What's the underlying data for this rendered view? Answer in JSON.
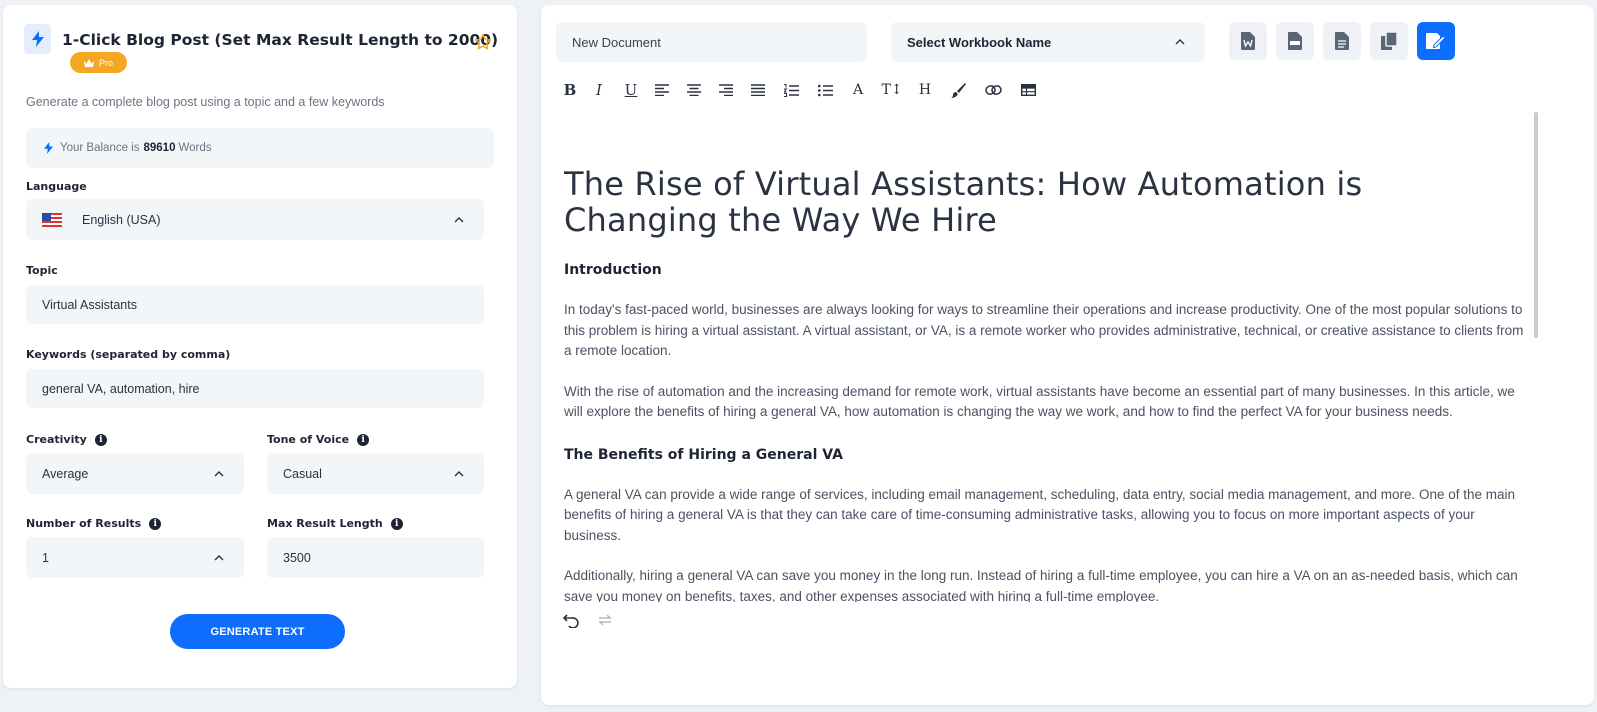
{
  "tool": {
    "title": "1-Click Blog Post (Set Max Result Length to 2000)",
    "badge": "Pro",
    "description": "Generate a complete blog post using a topic and a few keywords",
    "balance_prefix": "Your Balance is",
    "balance_value": "89610",
    "balance_suffix": "Words"
  },
  "form": {
    "language_label": "Language",
    "language_value": "English (USA)",
    "topic_label": "Topic",
    "topic_value": "Virtual Assistants",
    "keywords_label": "Keywords (separated by comma)",
    "keywords_value": "general VA, automation, hire",
    "creativity_label": "Creativity",
    "creativity_value": "Average",
    "tone_label": "Tone of Voice",
    "tone_value": "Casual",
    "results_label": "Number of Results",
    "results_value": "1",
    "maxlen_label": "Max Result Length",
    "maxlen_value": "3500",
    "generate_label": "GENERATE TEXT"
  },
  "editor_header": {
    "document_name": "New Document",
    "workbook_placeholder": "Select Workbook Name"
  },
  "document": {
    "title": "The Rise of Virtual Assistants: How Automation is Changing the Way We Hire",
    "intro_heading": "Introduction",
    "p1": "In today's fast-paced world, businesses are always looking for ways to streamline their operations and increase productivity. One of the most popular solutions to this problem is hiring a virtual assistant. A virtual assistant, or VA, is a remote worker who provides administrative, technical, or creative assistance to clients from a remote location.",
    "p2": "With the rise of automation and the increasing demand for remote work, virtual assistants have become an essential part of many businesses. In this article, we will explore the benefits of hiring a general VA, how automation is changing the way we work, and how to find the perfect VA for your business needs.",
    "benefits_heading": "The Benefits of Hiring a General VA",
    "p3": "A general VA can provide a wide range of services, including email management, scheduling, data entry, social media management, and more. One of the main benefits of hiring a general VA is that they can take care of time-consuming administrative tasks, allowing you to focus on more important aspects of your business.",
    "p4": "Additionally, hiring a general VA can save you money in the long run. Instead of hiring a full-time employee, you can hire a VA on an as-needed basis, which can save you money on benefits, taxes, and other expenses associated with hiring a full-time employee."
  },
  "colors": {
    "accent": "#0d6efd",
    "badge": "#f5a623",
    "field_bg": "#f3f6f9"
  },
  "icons": [
    "bolt-icon",
    "star-icon",
    "crown-icon",
    "info-icon",
    "chevron-up-icon",
    "word-icon",
    "pdf-icon",
    "txt-icon",
    "copy-icon",
    "save-icon",
    "undo-icon",
    "redo-icon"
  ]
}
